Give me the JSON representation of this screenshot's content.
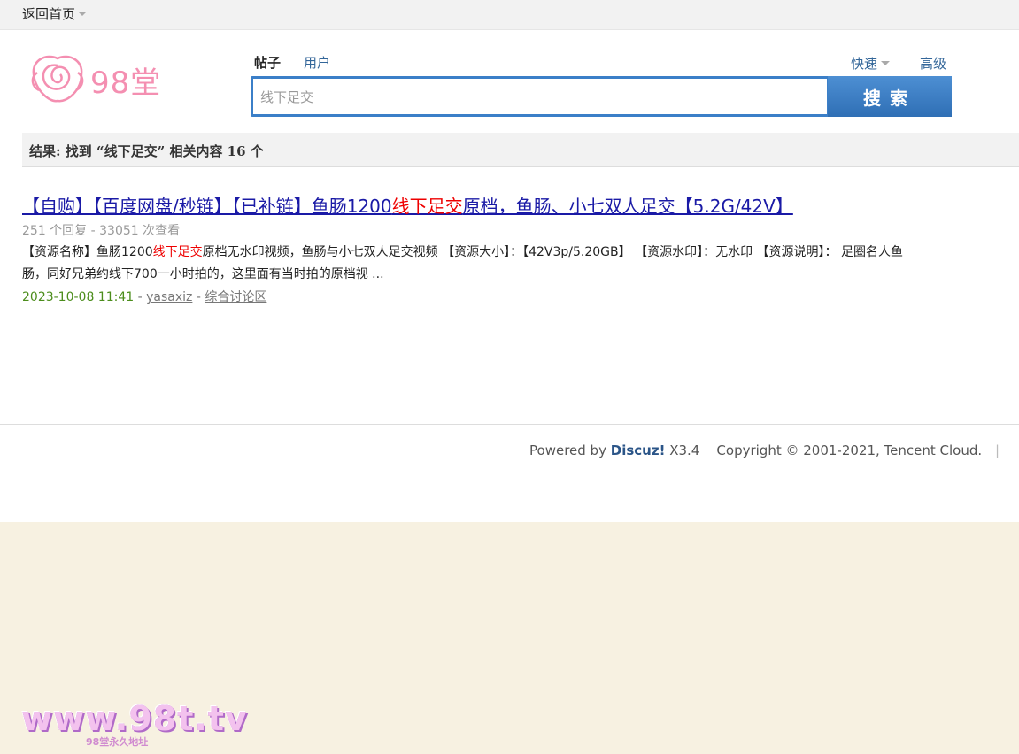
{
  "topbar": {
    "home_label": "返回首页"
  },
  "logo": {
    "text": "98堂"
  },
  "search": {
    "types": [
      "帖子",
      "用户"
    ],
    "quick_label": "快速",
    "advanced_label": "高级",
    "value": "线下足交",
    "button_label": "搜索"
  },
  "result": {
    "summary": "结果: 找到 “线下足交” 相关内容 16 个"
  },
  "items": [
    {
      "title_before": "【自购】【百度网盘/秒链】【已补链】鱼肠1200",
      "title_highlight": "线下足交",
      "title_after": "原档，鱼肠、小七双人足交【5.2G/42V】",
      "stats": "251 个回复 - 33051 次查看",
      "summary_before": "【资源名称】鱼肠1200",
      "summary_highlight": "线下足交",
      "summary_after": "原档无水印视频，鱼肠与小七双人足交视频 【资源大小】：【42V3p/5.20GB】 【资源水印】：无水印 【资源说明】： 足圈名人鱼肠，同好兄弟约线下700一小时拍的，这里面有当时拍的原档视 ...",
      "date": "2023-10-08 11:41",
      "author": "yasaxiz",
      "forum": "综合讨论区"
    }
  ],
  "footer": {
    "powered_by": "Powered by",
    "brand": "Discuz!",
    "version": "X3.4",
    "copyright": "Copyright © 2001-2021, Tencent Cloud."
  },
  "watermark": {
    "main": "www.98t.tv",
    "sub": "98堂永久地址"
  },
  "colors": {
    "accent": "#3b7fc8",
    "highlight": "#ee0000",
    "link": "#1a1aa6"
  }
}
